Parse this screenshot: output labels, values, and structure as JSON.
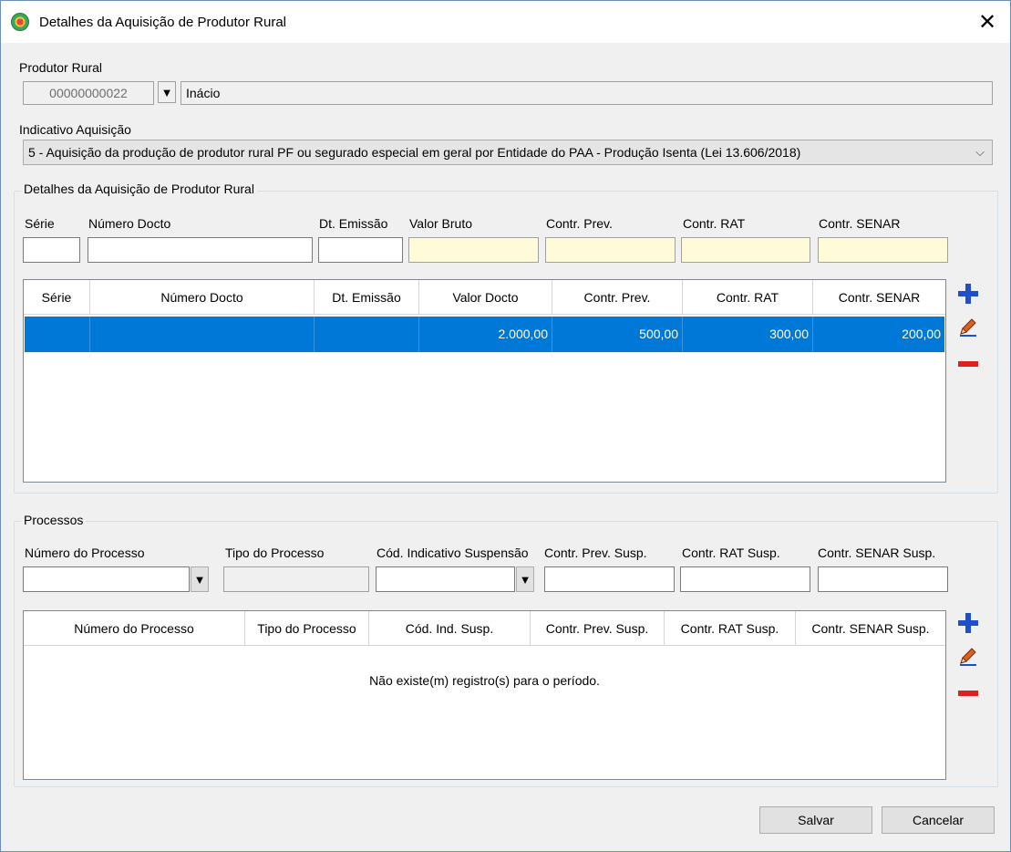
{
  "window": {
    "title": "Detalhes da Aquisição de Produtor Rural",
    "close_glyph": "✕"
  },
  "produtor": {
    "label": "Produtor Rural",
    "code": "00000000022",
    "name": "Inácio",
    "dropdown_glyph": "▼"
  },
  "indicativo": {
    "label": "Indicativo Aquisição",
    "value": "5 - Aquisição da produção de produtor rural PF ou segurado especial em geral por Entidade do PAA - Produção Isenta (Lei 13.606/2018)",
    "chevron": "⌵"
  },
  "detalhes": {
    "group_title": "Detalhes da Aquisição de Produtor Rural",
    "labels": {
      "serie": "Série",
      "numero": "Número Docto",
      "dt_emissao": "Dt. Emissão",
      "valor_bruto": "Valor Bruto",
      "contr_prev": "Contr. Prev.",
      "contr_rat": "Contr. RAT",
      "contr_senar": "Contr. SENAR"
    },
    "grid_headers": [
      "Série",
      "Número Docto",
      "Dt. Emissão",
      "Valor Docto",
      "Contr. Prev.",
      "Contr. RAT",
      "Contr. SENAR"
    ],
    "rows": [
      {
        "serie": "",
        "numero": "",
        "dt_emissao": "",
        "valor": "2.000,00",
        "prev": "500,00",
        "rat": "300,00",
        "senar": "200,00"
      }
    ]
  },
  "processos": {
    "group_title": "Processos",
    "labels": {
      "numero": "Número do Processo",
      "tipo": "Tipo do Processo",
      "cod": "Cód. Indicativo Suspensão",
      "prev": "Contr. Prev. Susp.",
      "rat": "Contr. RAT Susp.",
      "senar": "Contr. SENAR Susp."
    },
    "grid_headers": [
      "Número do Processo",
      "Tipo do Processo",
      "Cód. Ind. Susp.",
      "Contr. Prev. Susp.",
      "Contr. RAT Susp.",
      "Contr. SENAR Susp."
    ],
    "empty_message": "Não existe(m) registro(s) para o período."
  },
  "buttons": {
    "save": "Salvar",
    "cancel": "Cancelar"
  },
  "icons": {
    "app": "app-globe-icon",
    "add": "plus-icon",
    "edit": "pencil-icon",
    "remove": "minus-icon"
  },
  "colors": {
    "selection": "#0078d7",
    "highlight_field": "#fffbd9",
    "add_icon": "#1f4fc9",
    "remove_icon": "#e01f1f"
  }
}
